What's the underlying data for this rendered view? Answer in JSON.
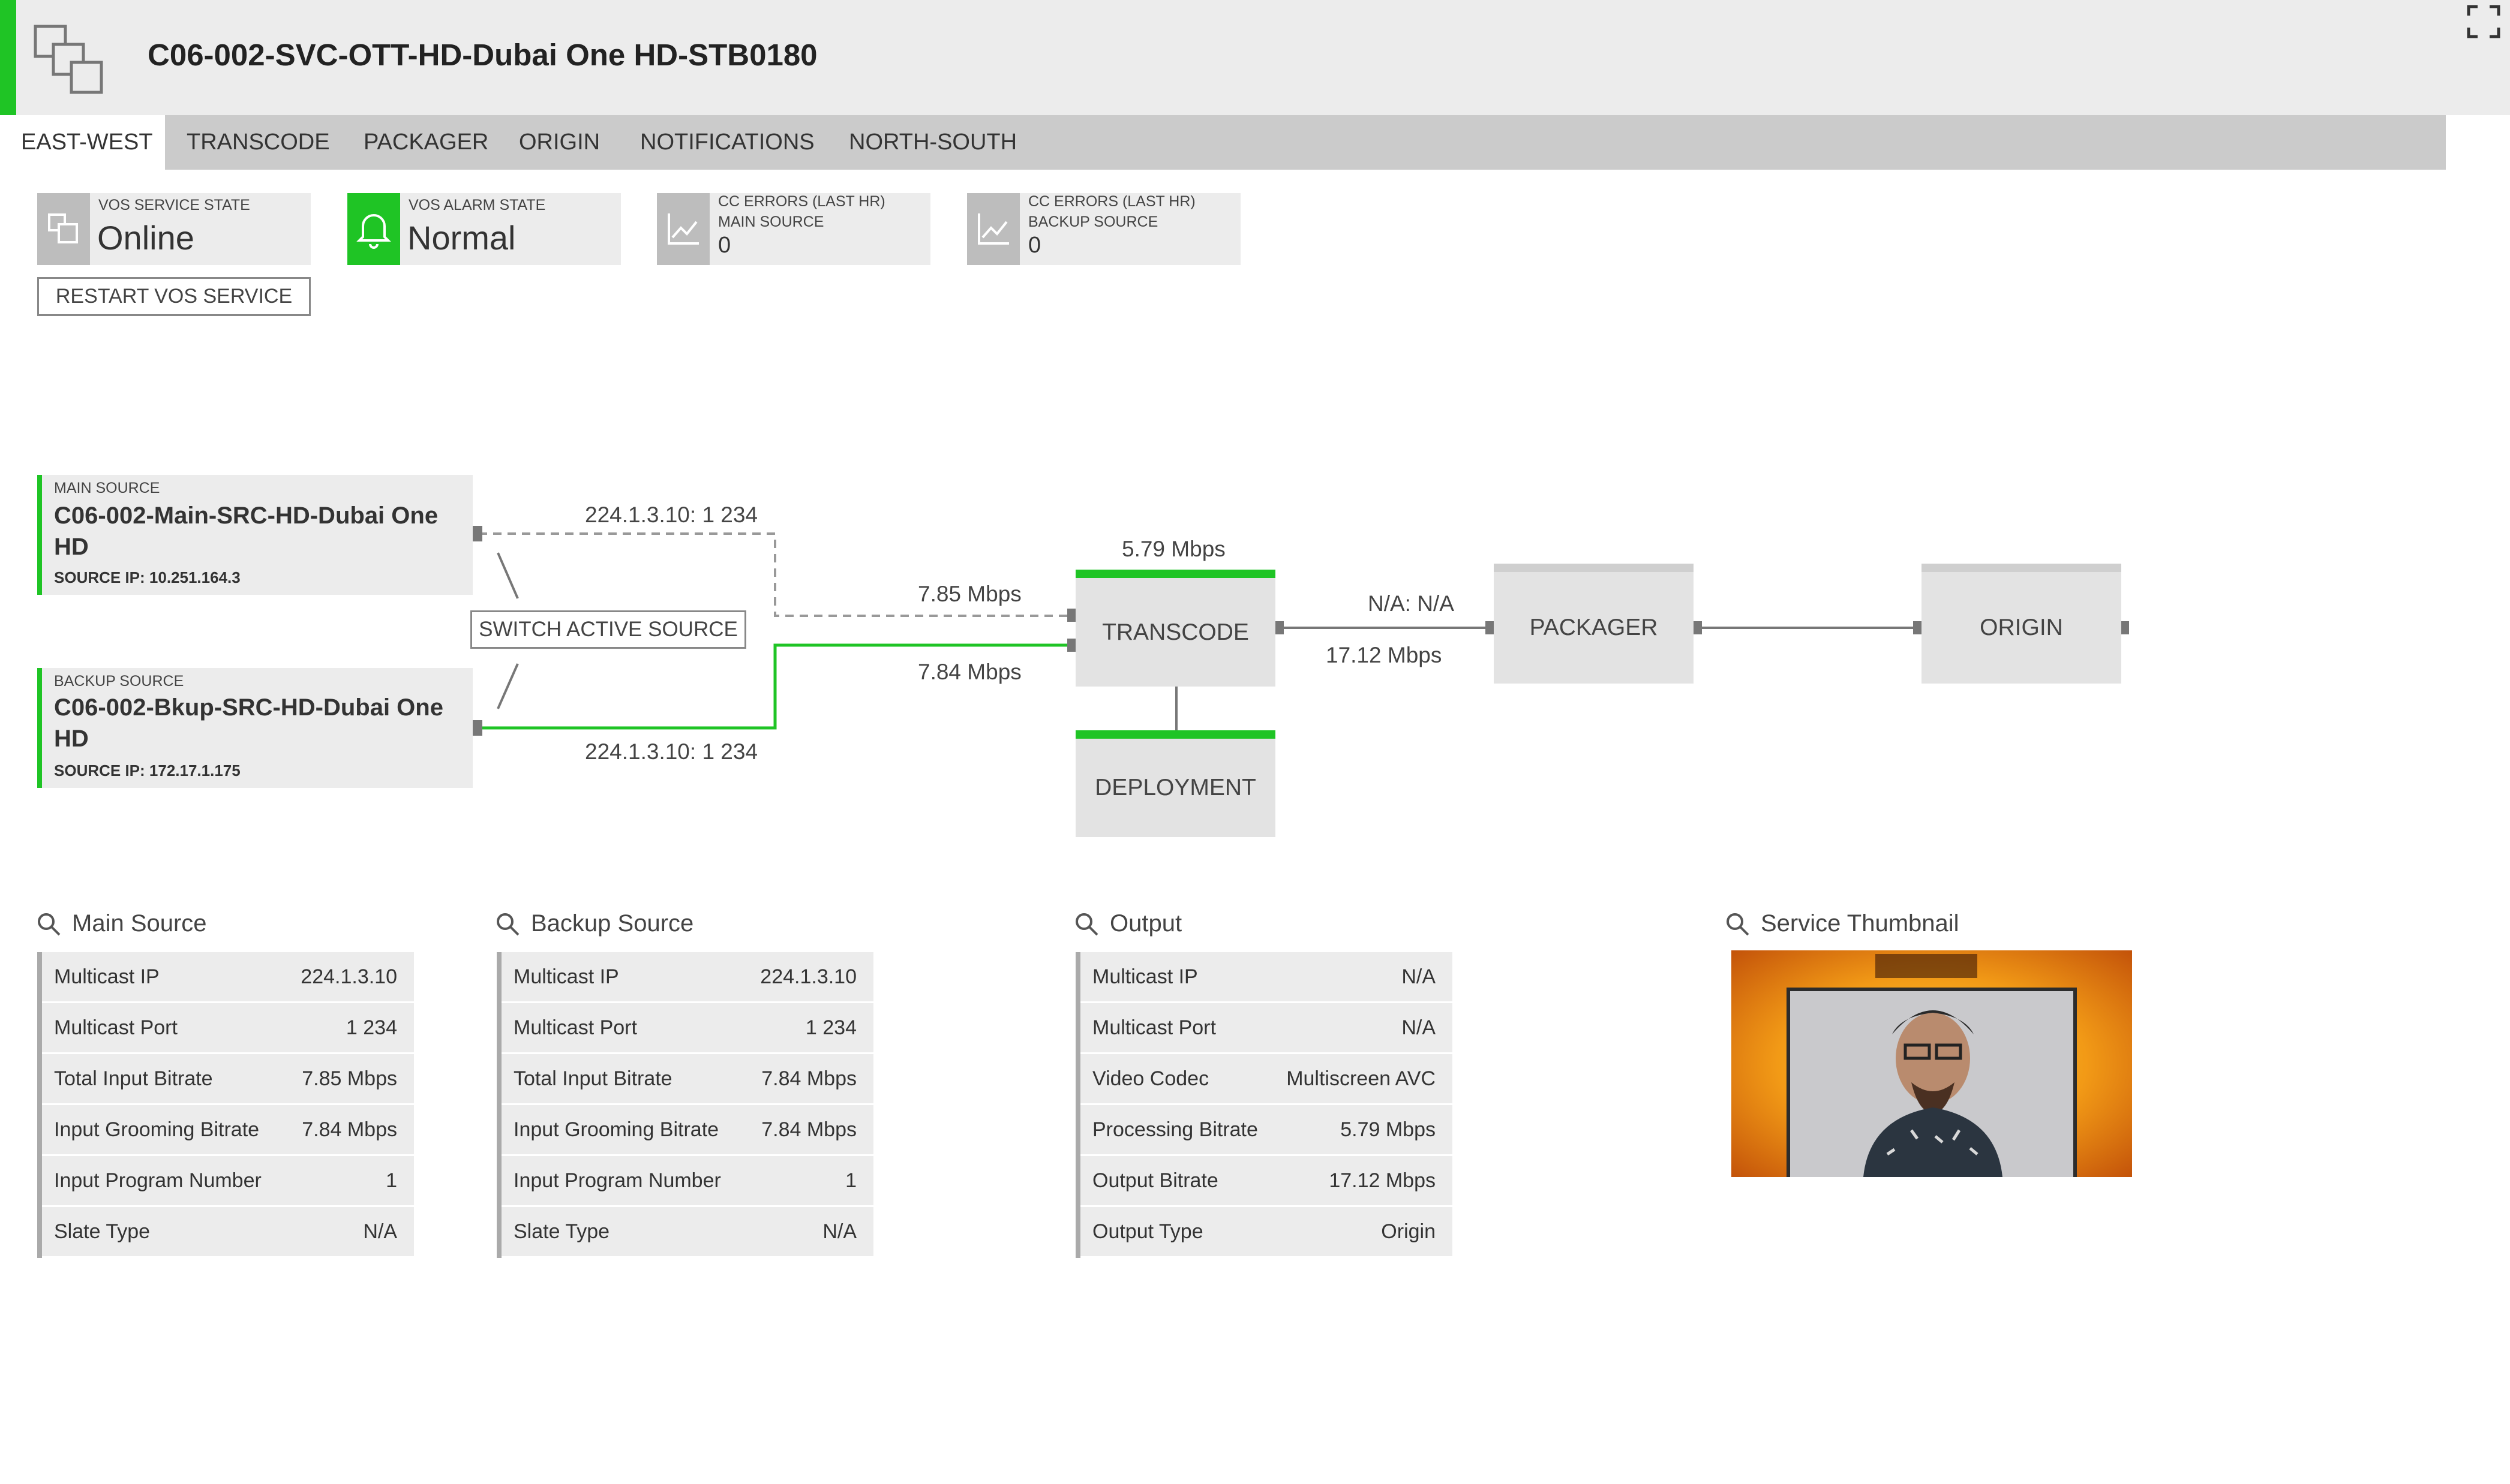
{
  "header": {
    "title": "C06-002-SVC-OTT-HD-Dubai One HD-STB0180"
  },
  "tabs": [
    {
      "label": "EAST-WEST",
      "active": true
    },
    {
      "label": "TRANSCODE",
      "active": false
    },
    {
      "label": "PACKAGER",
      "active": false
    },
    {
      "label": "ORIGIN",
      "active": false
    },
    {
      "label": "NOTIFICATIONS",
      "active": false
    },
    {
      "label": "NORTH-SOUTH",
      "active": false
    }
  ],
  "status": {
    "service_state": {
      "label": "VOS SERVICE STATE",
      "value": "Online"
    },
    "alarm_state": {
      "label": "VOS ALARM STATE",
      "value": "Normal"
    },
    "cc_main": {
      "label_line1": "CC ERRORS (LAST HR)",
      "label_line2": "MAIN SOURCE",
      "value": "0"
    },
    "cc_backup": {
      "label_line1": "CC ERRORS (LAST HR)",
      "label_line2": "BACKUP SOURCE",
      "value": "0"
    },
    "restart_label": "RESTART VOS SERVICE"
  },
  "diagram": {
    "main_source": {
      "caption": "MAIN SOURCE",
      "name": "C06-002-Main-SRC-HD-Dubai One HD",
      "ip": "SOURCE IP: 10.251.164.3"
    },
    "backup_source": {
      "caption": "BACKUP SOURCE",
      "name": "C06-002-Bkup-SRC-HD-Dubai One HD",
      "ip": "SOURCE IP: 172.17.1.175"
    },
    "main_addr": "224.1.3.10: 1 234",
    "backup_addr": "224.1.3.10: 1 234",
    "switch_label": "SWITCH ACTIVE SOURCE",
    "main_bitrate": "7.85 Mbps",
    "backup_bitrate": "7.84 Mbps",
    "transcode_bitrate": "5.79 Mbps",
    "packager_in": "N/A: N/A",
    "packager_bitrate": "17.12 Mbps",
    "nodes": {
      "transcode": "TRANSCODE",
      "deployment": "DEPLOYMENT",
      "packager": "PACKAGER",
      "origin": "ORIGIN"
    },
    "colors": {
      "active": "#1fc425",
      "inactive": "#999999"
    }
  },
  "tables": {
    "main": {
      "title": "Main Source",
      "rows": [
        {
          "label": "Multicast IP",
          "value": "224.1.3.10"
        },
        {
          "label": "Multicast Port",
          "value": "1 234"
        },
        {
          "label": "Total Input Bitrate",
          "value": "7.85 Mbps"
        },
        {
          "label": "Input Grooming Bitrate",
          "value": "7.84 Mbps"
        },
        {
          "label": "Input Program Number",
          "value": "1"
        },
        {
          "label": "Slate Type",
          "value": "N/A"
        }
      ]
    },
    "backup": {
      "title": "Backup Source",
      "rows": [
        {
          "label": "Multicast IP",
          "value": "224.1.3.10"
        },
        {
          "label": "Multicast Port",
          "value": "1 234"
        },
        {
          "label": "Total Input Bitrate",
          "value": "7.84 Mbps"
        },
        {
          "label": "Input Grooming Bitrate",
          "value": "7.84 Mbps"
        },
        {
          "label": "Input Program Number",
          "value": "1"
        },
        {
          "label": "Slate Type",
          "value": "N/A"
        }
      ]
    },
    "output": {
      "title": "Output",
      "rows": [
        {
          "label": "Multicast IP",
          "value": "N/A"
        },
        {
          "label": "Multicast Port",
          "value": "N/A"
        },
        {
          "label": "Video Codec",
          "value": "Multiscreen AVC"
        },
        {
          "label": "Processing Bitrate",
          "value": "5.79 Mbps"
        },
        {
          "label": "Output Bitrate",
          "value": "17.12 Mbps"
        },
        {
          "label": "Output Type",
          "value": "Origin"
        }
      ]
    }
  },
  "thumbnail": {
    "title": "Service Thumbnail"
  }
}
